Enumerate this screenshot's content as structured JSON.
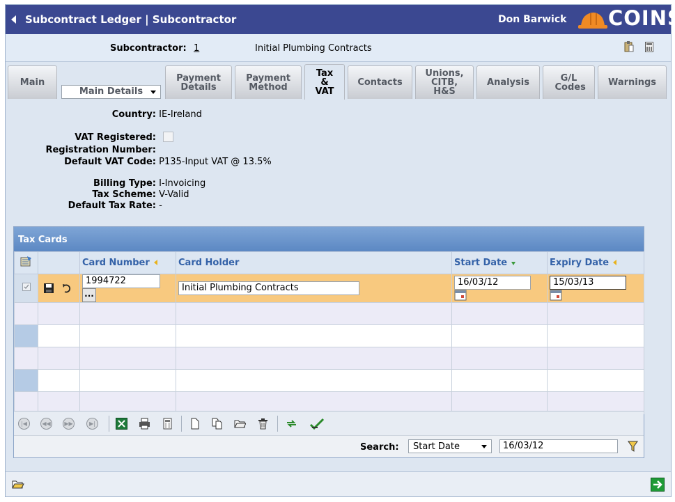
{
  "header": {
    "title": "Subcontract Ledger | Subcontractor",
    "user": "Don Barwick",
    "logo_text": "COINS",
    "brand_color": "#3b4891",
    "logo_color": "#f08a24"
  },
  "subbar": {
    "label": "Subcontractor:",
    "code": "1",
    "name": "Initial Plumbing Contracts"
  },
  "tabs": [
    {
      "label": "Main"
    },
    {
      "label": "Payment Details"
    },
    {
      "label": "Payment Method"
    },
    {
      "label": "Tax & VAT",
      "active": true
    },
    {
      "label": "Contacts"
    },
    {
      "label": "Unions, CITB, H&S"
    },
    {
      "label": "Analysis"
    },
    {
      "label": "G/L Codes"
    },
    {
      "label": "Warnings"
    }
  ],
  "view_select": {
    "value": "Main Details"
  },
  "details": {
    "country": {
      "label": "Country:",
      "value": "IE-Ireland"
    },
    "vat_registered": {
      "label": "VAT Registered:",
      "checked": false
    },
    "registration_number": {
      "label": "Registration Number:",
      "value": ""
    },
    "default_vat_code": {
      "label": "Default VAT Code:",
      "value": "P135-Input VAT @ 13.5%"
    },
    "billing_type": {
      "label": "Billing Type:",
      "value": "I-Invoicing"
    },
    "tax_scheme": {
      "label": "Tax Scheme:",
      "value": "V-Valid"
    },
    "default_tax_rate": {
      "label": "Default Tax Rate:",
      "value": "-"
    }
  },
  "tax_cards": {
    "title": "Tax Cards",
    "columns": {
      "card_number": "Card Number",
      "card_holder": "Card Holder",
      "start_date": "Start Date",
      "expiry_date": "Expiry Date"
    },
    "rows": [
      {
        "card_number": "1994722",
        "card_holder": "Initial Plumbing Contracts",
        "start_date": "16/03/12",
        "expiry_date": "15/03/13"
      }
    ],
    "lookup_button": "..."
  },
  "search": {
    "label": "Search:",
    "field": "Start Date",
    "value": "16/03/12"
  }
}
